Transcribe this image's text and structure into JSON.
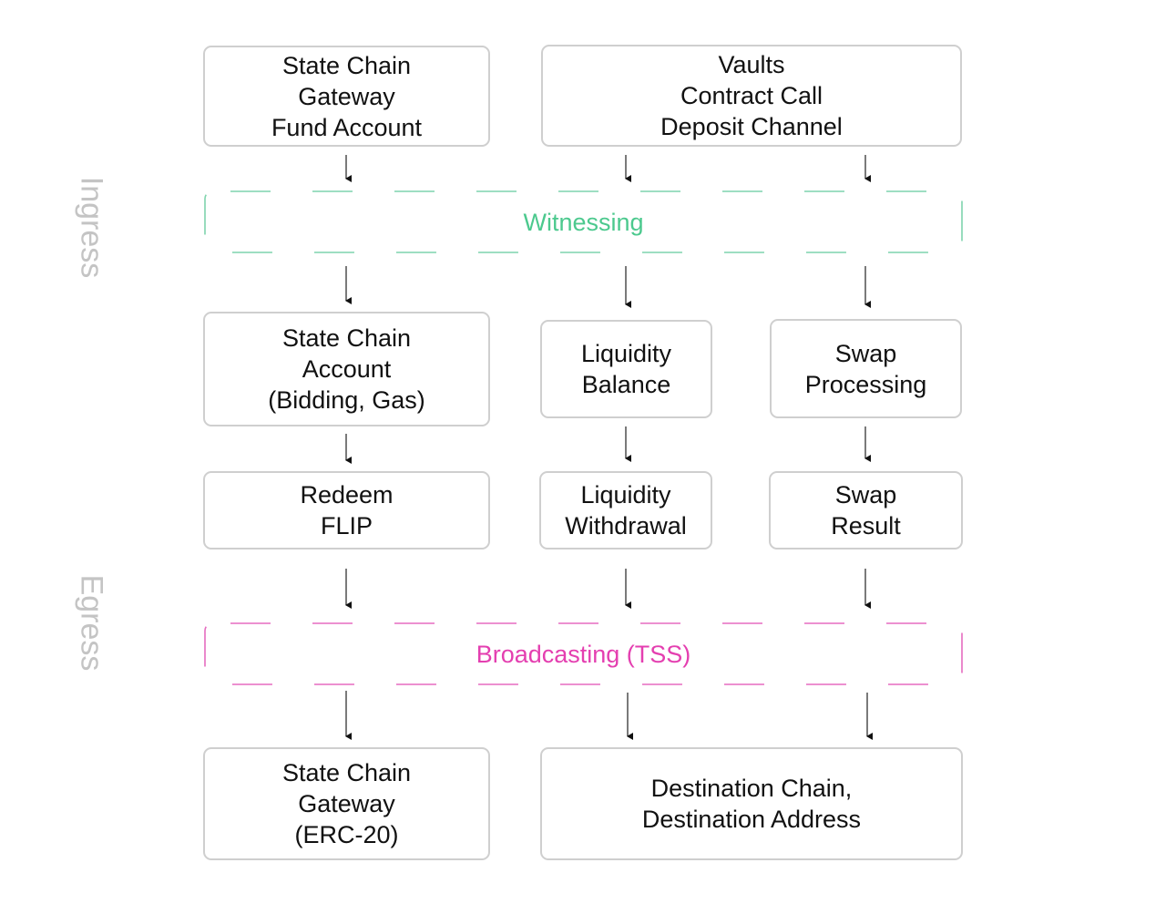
{
  "sections": {
    "ingress": "Ingress",
    "egress": "Egress"
  },
  "bands": {
    "witnessing": {
      "label": "Witnessing",
      "color": "#4cc98e"
    },
    "broadcasting": {
      "label": "Broadcasting (TSS)",
      "color": "#e43fb0"
    }
  },
  "nodes": {
    "sc_gateway_fund": "State Chain\nGateway\nFund Account",
    "vaults": "Vaults\nContract Call\nDeposit Channel",
    "sc_account": "State Chain\nAccount\n(Bidding, Gas)",
    "liquidity_balance": "Liquidity\nBalance",
    "swap_processing": "Swap\nProcessing",
    "redeem_flip": "Redeem\nFLIP",
    "liquidity_withdrawal": "Liquidity\nWithdrawal",
    "swap_result": "Swap\nResult",
    "sc_gateway_erc20": "State Chain\nGateway\n(ERC-20)",
    "destination": "Destination Chain,\nDestination Address"
  },
  "edges": [
    [
      "sc_gateway_fund",
      "witnessing"
    ],
    [
      "vaults",
      "witnessing"
    ],
    [
      "vaults",
      "witnessing"
    ],
    [
      "witnessing",
      "sc_account"
    ],
    [
      "witnessing",
      "liquidity_balance"
    ],
    [
      "witnessing",
      "swap_processing"
    ],
    [
      "sc_account",
      "redeem_flip"
    ],
    [
      "liquidity_balance",
      "liquidity_withdrawal"
    ],
    [
      "swap_processing",
      "swap_result"
    ],
    [
      "redeem_flip",
      "broadcasting"
    ],
    [
      "liquidity_withdrawal",
      "broadcasting"
    ],
    [
      "swap_result",
      "broadcasting"
    ],
    [
      "broadcasting",
      "sc_gateway_erc20"
    ],
    [
      "broadcasting",
      "destination"
    ],
    [
      "broadcasting",
      "destination"
    ]
  ]
}
